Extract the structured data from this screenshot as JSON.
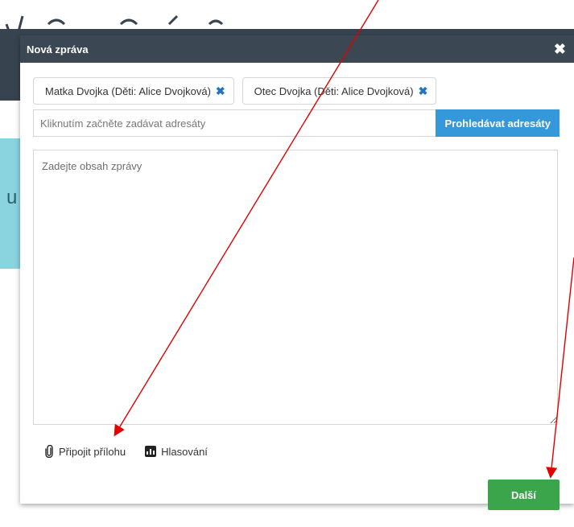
{
  "modal": {
    "title": "Nová zpráva",
    "close_symbol": "✖"
  },
  "recipients": {
    "chips": [
      {
        "label": "Matka Dvojka (Děti: Alice Dvojková)",
        "remove_symbol": "✖"
      },
      {
        "label": "Otec Dvojka (Děti: Alice Dvojková)",
        "remove_symbol": "✖"
      }
    ],
    "input_placeholder": "Kliknutím začněte zadávat adresáty",
    "search_button": "Prohledávat adresáty"
  },
  "message": {
    "placeholder": "Zadejte obsah zprávy"
  },
  "actions": {
    "attach_label": "Připojit přílohu",
    "attach_icon": "paperclip-icon",
    "poll_label": "Hlasování",
    "poll_icon": "poll-chart-icon"
  },
  "footer": {
    "next_button": "Další"
  },
  "colors": {
    "header": "#3b4752",
    "primary": "#3498db",
    "success": "#3aa54b",
    "annotation_arrow": "#e00000"
  }
}
